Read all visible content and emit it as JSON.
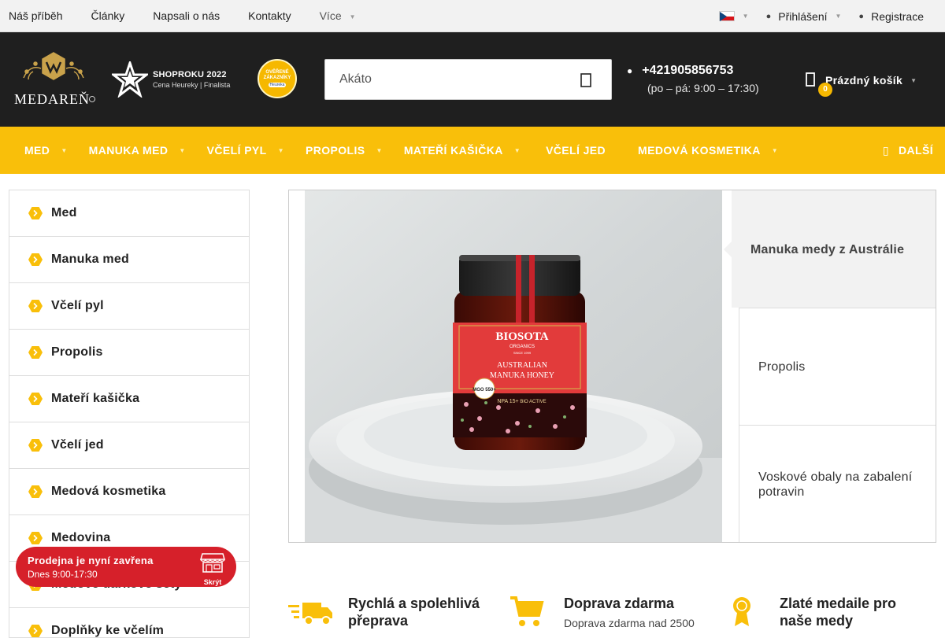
{
  "topbar": {
    "links": [
      "Náš příběh",
      "Články",
      "Napsali o nás",
      "Kontakty"
    ],
    "more_label": "Více",
    "language": "CZ",
    "login_label": "Přihlášení",
    "register_label": "Registrace"
  },
  "header": {
    "logo_text": "MEDAREŇ",
    "award_title": "SHOPROKU 2022",
    "award_sub": "Cena Heureky | Finalista",
    "seal_text": "OVĚŘENÉ ZÁKAZNÍKY",
    "seal_brand": "Heureka",
    "search_placeholder": "Akáto",
    "phone": "+421905856753",
    "hours": "(po – pá: 9:00 – 17:30)",
    "cart_label": "Prázdný košík",
    "cart_count": "0"
  },
  "menu": {
    "items": [
      {
        "label": "MED",
        "has_caret": true
      },
      {
        "label": "MANUKA MED",
        "has_caret": true
      },
      {
        "label": "VČELÍ PYL",
        "has_caret": true
      },
      {
        "label": "PROPOLIS",
        "has_caret": true
      },
      {
        "label": "MATEŘÍ KAŠIČKA",
        "has_caret": true
      },
      {
        "label": "VČELÍ JED",
        "has_caret": false
      },
      {
        "label": "MEDOVÁ KOSMETIKA",
        "has_caret": true
      }
    ],
    "more_label": "DALŠÍ"
  },
  "sidebar": {
    "items": [
      "Med",
      "Manuka med",
      "Včelí pyl",
      "Propolis",
      "Mateří kašička",
      "Včelí jed",
      "Medová kosmetika",
      "Medovina",
      "Medové dárkové sety",
      "Doplňky ke včelím"
    ]
  },
  "store_popup": {
    "title": "Prodejna je nyní zavřena",
    "hours": "Dnes 9:00-17:30",
    "hide_label": "Skrýt"
  },
  "hero": {
    "jar_brand": "BIOSOTA",
    "jar_sub": "ORGANICS",
    "jar_since": "SINCE 1999",
    "jar_name_1": "AUSTRALIAN",
    "jar_name_2": "MANUKA HONEY",
    "jar_mgo": "MGO 550+",
    "jar_npa": "NPA 15+",
    "jar_bio": "BIO ACTIVE",
    "tabs": [
      {
        "label": "Manuka medy z Austrálie",
        "active": true
      },
      {
        "label": "Propolis",
        "active": false
      },
      {
        "label": "Voskové obaly na zabalení potravin",
        "active": false
      }
    ]
  },
  "features": [
    {
      "title": "Rychlá a spolehlivá přeprava",
      "desc": ""
    },
    {
      "title": "Doprava zdarma",
      "desc": "Doprava zdarma nad 2500"
    },
    {
      "title": "Zlaté medaile pro naše medy",
      "desc": ""
    }
  ],
  "colors": {
    "accent": "#f9bf0a",
    "header_bg": "#1f1f1f",
    "popup_bg": "#d6202a"
  }
}
